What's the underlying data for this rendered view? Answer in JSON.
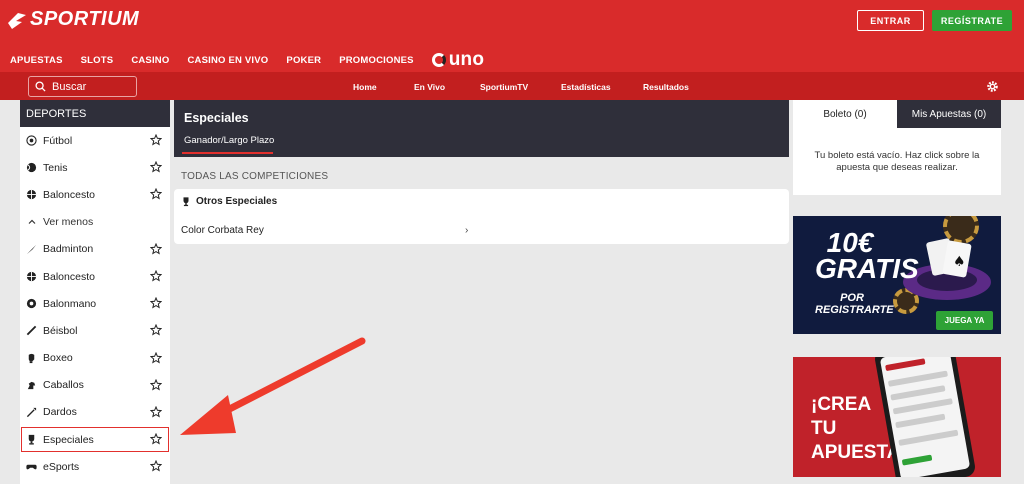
{
  "header": {
    "brand": "SPORTIUM",
    "login_label": "ENTRAR",
    "register_label": "REGÍSTRATE",
    "nav": [
      "APUESTAS",
      "SLOTS",
      "CASINO",
      "CASINO EN VIVO",
      "POKER",
      "PROMOCIONES"
    ],
    "uno_label": "uno"
  },
  "subheader": {
    "search_placeholder": "Buscar",
    "links": [
      "Home",
      "En Vivo",
      "SportiumTV",
      "Estadísticas",
      "Resultados"
    ]
  },
  "sidebar": {
    "title": "DEPORTES",
    "top": [
      "Fútbol",
      "Tenis",
      "Baloncesto"
    ],
    "less_label": "Ver menos",
    "sports": [
      "Badminton",
      "Baloncesto",
      "Balonmano",
      "Béisbol",
      "Boxeo",
      "Caballos",
      "Dardos",
      "Especiales",
      "eSports"
    ]
  },
  "center": {
    "title": "Especiales",
    "active_tab": "Ganador/Largo Plazo",
    "section_label": "TODAS LAS COMPETICIONES",
    "card_title": "Otros Especiales",
    "row_label": "Color Corbata Rey",
    "chevron": "›"
  },
  "betslip": {
    "tab_boleto": "Boleto (0)",
    "tab_mis_apuestas": "Mis Apuestas (0)",
    "empty_message": "Tu boleto está vacío. Haz click sobre la apuesta que deseas realizar."
  },
  "banners": {
    "promo_big": "10€ GRATIS",
    "promo_small": "POR REGISTRARTE",
    "promo_cta": "JUEGA YA",
    "crea_text": "¡CREA TU APUESTA!"
  },
  "colors": {
    "brand_red": "#d92b2b",
    "dark": "#2f2f3a",
    "green": "#2ea236",
    "annotation_arrow": "#ee3b2c"
  }
}
